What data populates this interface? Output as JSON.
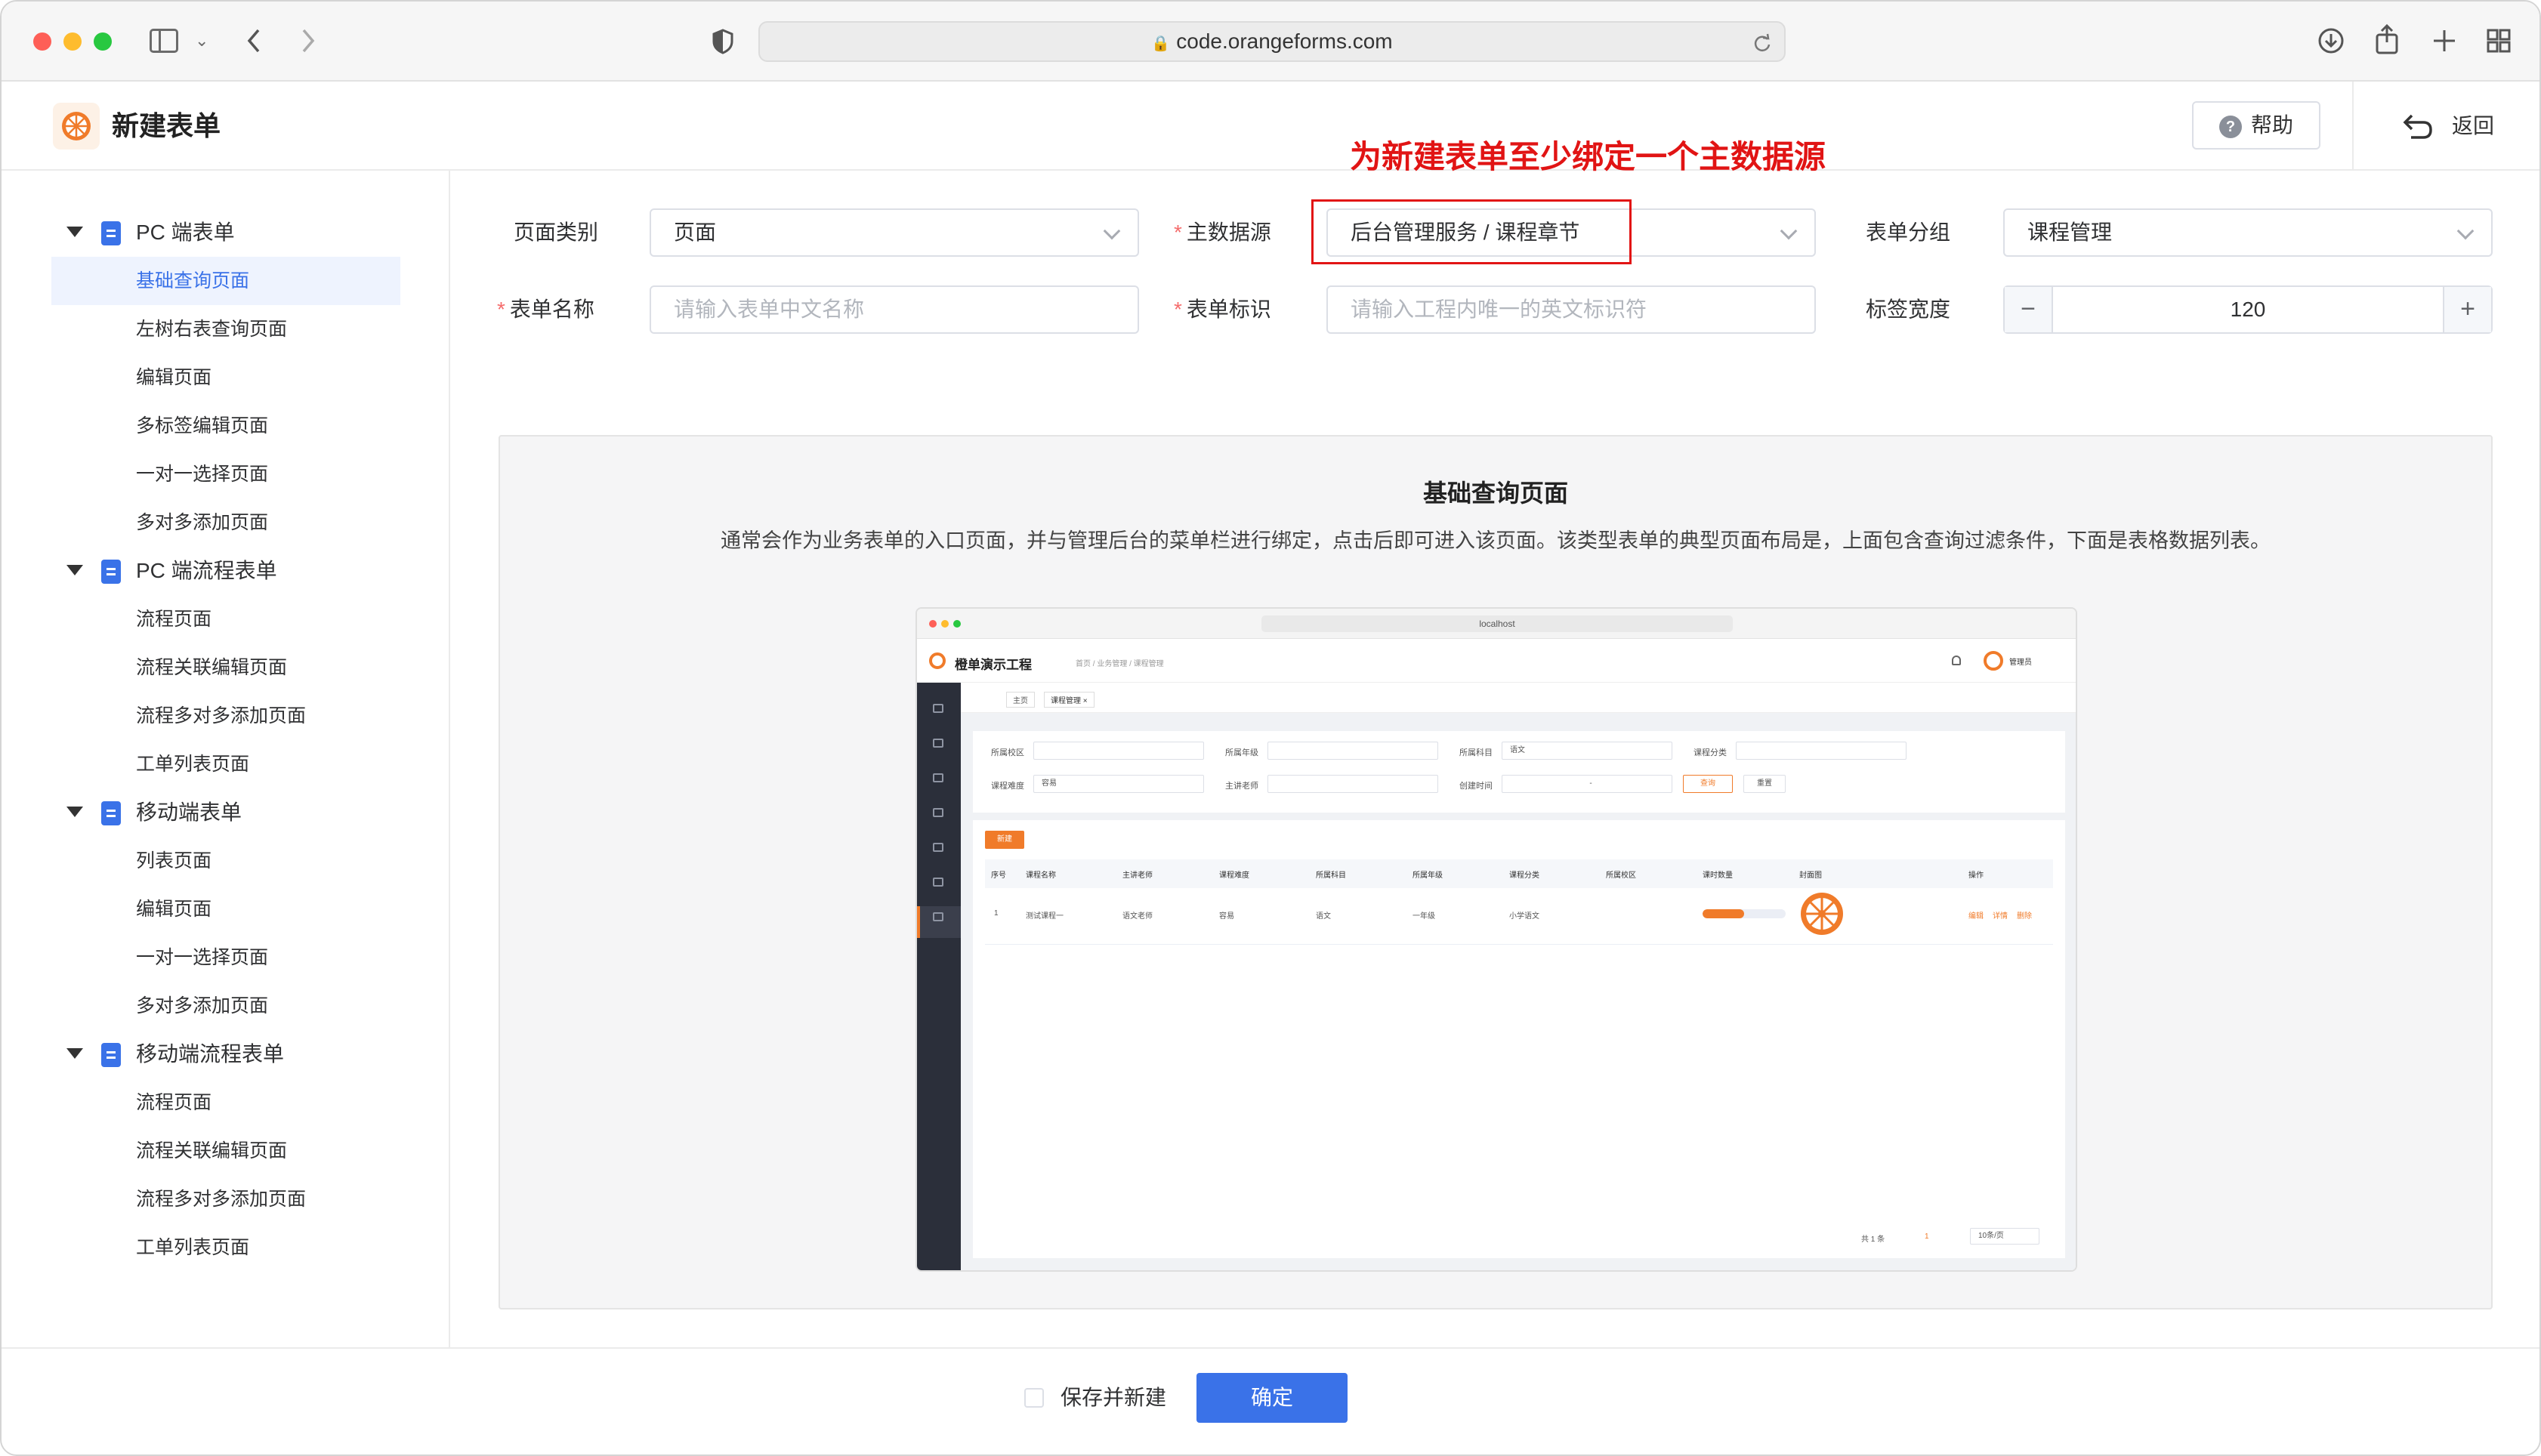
{
  "browser": {
    "url": "code.orangeforms.com"
  },
  "header": {
    "title": "新建表单",
    "help_label": "帮助",
    "back_label": "返回"
  },
  "annotation": {
    "text": "为新建表单至少绑定一个主数据源",
    "color": "#e11414"
  },
  "sidebar": {
    "groups": [
      {
        "label": "PC 端表单",
        "items": [
          "基础查询页面",
          "左树右表查询页面",
          "编辑页面",
          "多标签编辑页面",
          "一对一选择页面",
          "多对多添加页面"
        ]
      },
      {
        "label": "PC 端流程表单",
        "items": [
          "流程页面",
          "流程关联编辑页面",
          "流程多对多添加页面",
          "工单列表页面"
        ]
      },
      {
        "label": "移动端表单",
        "items": [
          "列表页面",
          "编辑页面",
          "一对一选择页面",
          "多对多添加页面"
        ]
      },
      {
        "label": "移动端流程表单",
        "items": [
          "流程页面",
          "流程关联编辑页面",
          "流程多对多添加页面",
          "工单列表页面"
        ]
      }
    ],
    "active_item": "基础查询页面"
  },
  "form": {
    "page_type_label": "页面类别",
    "page_type_value": "页面",
    "datasource_label": "主数据源",
    "datasource_value": "后台管理服务 / 课程章节",
    "group_label": "表单分组",
    "group_value": "课程管理",
    "name_label": "表单名称",
    "name_placeholder": "请输入表单中文名称",
    "id_label": "表单标识",
    "id_placeholder": "请输入工程内唯一的英文标识符",
    "width_label": "标签宽度",
    "width_value": "120",
    "minus": "−",
    "plus": "+"
  },
  "preview": {
    "title": "基础查询页面",
    "description": "通常会作为业务表单的入口页面，并与管理后台的菜单栏进行绑定，点击后即可进入该页面。该类型表单的典型页面布局是，上面包含查询过滤条件，下面是表格数据列表。",
    "mini": {
      "url": "localhost",
      "app_title": "橙单演示工程",
      "breadcrumb": "首页 / 业务管理 / 课程管理",
      "user": "管理员",
      "tabs": [
        "主页",
        "课程管理 ×"
      ],
      "filters": [
        {
          "label": "所属校区",
          "value": ""
        },
        {
          "label": "所属年级",
          "value": ""
        },
        {
          "label": "所属科目",
          "value": "语文"
        },
        {
          "label": "课程分类",
          "value": ""
        },
        {
          "label": "课程难度",
          "value": "容易"
        },
        {
          "label": "主讲老师",
          "value": ""
        },
        {
          "label": "创建时间",
          "value": "-"
        }
      ],
      "query_btn": "查询",
      "reset_btn": "重置",
      "new_btn": "新建",
      "columns": [
        "序号",
        "课程名称",
        "主讲老师",
        "课程难度",
        "所属科目",
        "所属年级",
        "课程分类",
        "所属校区",
        "课时数量",
        "封面图",
        "操作"
      ],
      "row": [
        "1",
        "测试课程一",
        "语文老师",
        "容易",
        "语文",
        "一年级",
        "小学语文",
        ""
      ],
      "hours_progress": 0.5,
      "actions": [
        "编辑",
        "详情",
        "删除"
      ],
      "pagination": {
        "total": "共 1 条",
        "page": "1",
        "size": "10条/页"
      }
    }
  },
  "footer": {
    "save_new_label": "保存并新建",
    "ok_label": "确定"
  },
  "colors": {
    "primary": "#3a72e8",
    "orange": "#f07b2a",
    "required": "#f56c6c"
  }
}
